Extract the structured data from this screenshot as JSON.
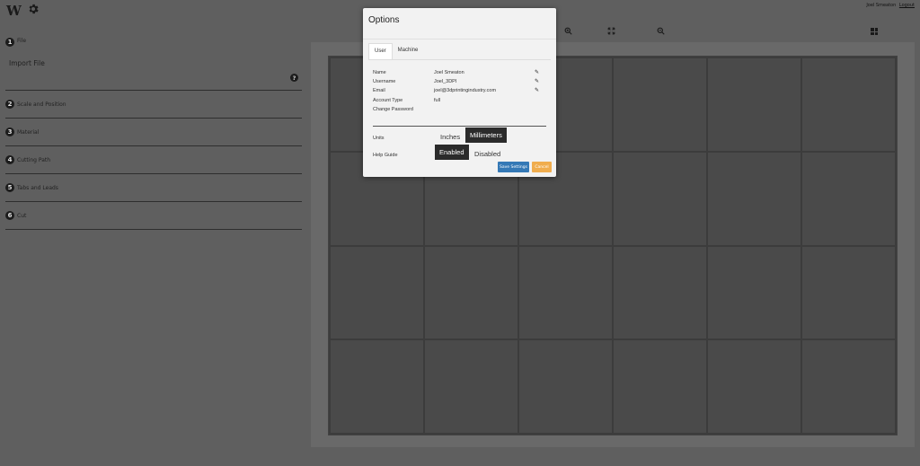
{
  "app": {
    "logo_text": "W",
    "user_name": "Joel Smeaton",
    "logout_label": "Logout"
  },
  "steps": [
    {
      "num": "1",
      "label": "File"
    },
    {
      "num": "2",
      "label": "Scale and Position"
    },
    {
      "num": "3",
      "label": "Material"
    },
    {
      "num": "4",
      "label": "Cutting Path"
    },
    {
      "num": "5",
      "label": "Tabs and Leads"
    },
    {
      "num": "6",
      "label": "Cut"
    }
  ],
  "import": {
    "label": "Import File",
    "help_glyph": "?"
  },
  "icons": {
    "logo": "logo-w-icon",
    "settings": "gear-icon",
    "zoom_in": "zoom-in-icon",
    "fit": "fit-screen-icon",
    "zoom_out": "zoom-out-icon",
    "apps": "grid-icon",
    "help": "help-icon",
    "edit": "pencil-icon"
  },
  "modal": {
    "title": "Options",
    "tabs": [
      "User",
      "Machine"
    ],
    "active_tab": "User",
    "fields": [
      {
        "label": "Name",
        "value": "Joel Smeaton",
        "editable": true
      },
      {
        "label": "Username",
        "value": "Joel_3DPI",
        "editable": true
      },
      {
        "label": "Email",
        "value": "joel@3dprintingindustry.com",
        "editable": true
      },
      {
        "label": "Account Type",
        "value": "full",
        "editable": false
      },
      {
        "label": "Change Password",
        "value": "",
        "editable": false
      }
    ],
    "units": {
      "label": "Units",
      "options": [
        "Inches",
        "Millimeters"
      ],
      "selected": "Millimeters"
    },
    "help_guide": {
      "label": "Help Guide",
      "options": [
        "Enabled",
        "Disabled"
      ],
      "selected": "Enabled"
    },
    "save_label": "Save Settings",
    "cancel_label": "Cancel"
  },
  "colors": {
    "background": "#5f5f5f",
    "modal_bg": "#f2f2f2",
    "primary": "#3579b6",
    "warning": "#f0ad4e",
    "toggle_active": "#2b2b2b"
  }
}
